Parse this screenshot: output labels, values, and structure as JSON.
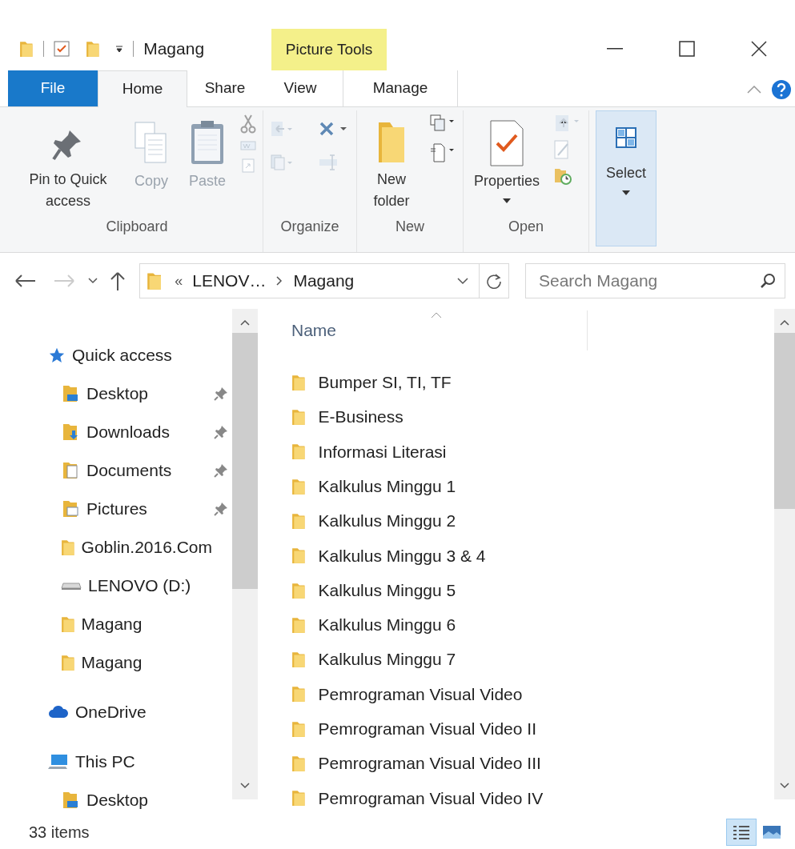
{
  "window": {
    "title": "Magang",
    "contextual_tab": "Picture Tools"
  },
  "tabs": [
    {
      "label": "File",
      "kind": "file",
      "selected": false
    },
    {
      "label": "Home",
      "kind": "normal",
      "selected": true
    },
    {
      "label": "Share",
      "kind": "normal",
      "selected": false
    },
    {
      "label": "View",
      "kind": "normal",
      "selected": false
    },
    {
      "label": "Manage",
      "kind": "contextual",
      "selected": false
    }
  ],
  "ribbon": [
    {
      "label": "Clipboard",
      "buttons": [
        {
          "kind": "pin",
          "label": "Pin to Quick access",
          "disabled": false,
          "dropdown": false
        },
        {
          "kind": "copy",
          "label": "Copy",
          "disabled": true,
          "dropdown": false
        },
        {
          "kind": "paste",
          "label": "Paste",
          "disabled": true,
          "dropdown": false
        },
        {
          "kind": "clipboard_small",
          "disabled": true
        }
      ]
    },
    {
      "label": "Organize",
      "buttons": [
        {
          "kind": "organize_small",
          "disabled": true
        }
      ]
    },
    {
      "label": "New",
      "buttons": [
        {
          "kind": "folder",
          "label": "New folder",
          "disabled": false,
          "dropdown": false
        },
        {
          "kind": "new_small",
          "disabled": false
        }
      ]
    },
    {
      "label": "Open",
      "buttons": [
        {
          "kind": "properties",
          "label": "Properties",
          "disabled": false,
          "dropdown": true
        },
        {
          "kind": "open_small",
          "disabled": true
        }
      ]
    },
    {
      "buttons": [
        {
          "kind": "select",
          "label": "Select",
          "disabled": false,
          "dropdown": true,
          "selected": true
        }
      ]
    }
  ],
  "address": {
    "prefix": "«",
    "segments": [
      "LENOV…",
      "Magang"
    ],
    "search_placeholder": "Search Magang"
  },
  "nav_pane": [
    {
      "label": "Quick access",
      "kind": "star",
      "children": [
        {
          "label": "Desktop",
          "kind": "desktop",
          "pinned": true
        },
        {
          "label": "Downloads",
          "kind": "downloads",
          "pinned": true
        },
        {
          "label": "Documents",
          "kind": "documents",
          "pinned": true
        },
        {
          "label": "Pictures",
          "kind": "pictures",
          "pinned": true
        },
        {
          "label": "Goblin.2016.Com",
          "kind": "folder",
          "pinned": false
        },
        {
          "label": "LENOVO (D:)",
          "kind": "drive",
          "pinned": false
        },
        {
          "label": "Magang",
          "kind": "folder",
          "pinned": false
        },
        {
          "label": "Magang",
          "kind": "folder",
          "pinned": false
        }
      ]
    },
    {
      "label": "OneDrive",
      "kind": "cloud"
    },
    {
      "label": "This PC",
      "kind": "pc",
      "children": [
        {
          "label": "Desktop",
          "kind": "desktop",
          "pinned": false
        }
      ]
    }
  ],
  "file_list": {
    "column": "Name",
    "items": [
      "Bumper SI, TI, TF",
      "E-Business",
      "Informasi Literasi",
      "Kalkulus Minggu 1",
      "Kalkulus Minggu 2",
      "Kalkulus Minggu 3 & 4",
      "Kalkulus Minggu 5",
      "Kalkulus Minggu 6",
      "Kalkulus Minggu 7",
      "Pemrograman Visual Video",
      "Pemrograman Visual Video II",
      "Pemrograman Visual Video III",
      "Pemrograman Visual Video IV"
    ]
  },
  "status_bar": {
    "text": "33 items",
    "views": [
      {
        "kind": "details",
        "selected": true
      },
      {
        "kind": "large_icons",
        "selected": false
      }
    ]
  }
}
